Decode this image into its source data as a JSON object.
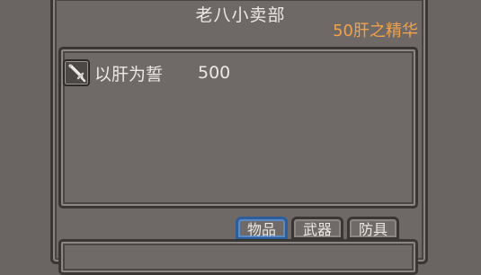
{
  "shop": {
    "title": "老八小卖部",
    "currency_label": "50肝之精华"
  },
  "items": [
    {
      "name": "以肝为誓",
      "price": "500",
      "icon": "sword-icon"
    }
  ],
  "tabs": [
    {
      "label": "物品",
      "active": true
    },
    {
      "label": "武器",
      "active": false
    },
    {
      "label": "防具",
      "active": false
    }
  ],
  "colors": {
    "currency": "#f0a24a",
    "text": "#ece8e4",
    "active_tab_border": "#2c5f9a"
  }
}
